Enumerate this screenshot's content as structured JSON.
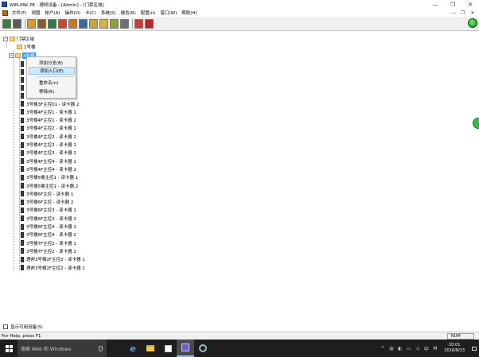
{
  "window": {
    "title": "WIN-PAK PE - 理邦设备 - [Admin] - [门禁区域]",
    "controls": [
      "—",
      "❐",
      "✕"
    ]
  },
  "menu": {
    "items": [
      "文件(F)",
      "视图",
      "帐户(A)",
      "操作(O)",
      "卡(C)",
      "系统(S)",
      "报告(R)",
      "配置(n)",
      "窗口(W)",
      "帮助(H)"
    ],
    "mdi_controls": [
      "—",
      "❐",
      "✕"
    ]
  },
  "toolbar": {
    "buttons": [
      {
        "icon": "door-icon",
        "color": "#3f7b3a"
      },
      {
        "icon": "grid-icon",
        "color": "#5b5b5b"
      },
      {
        "icon": "card-icon",
        "color": "#d89b2a"
      },
      {
        "icon": "book-icon",
        "color": "#8a5a2b"
      },
      {
        "icon": "person-icon",
        "color": "#2f7a3f"
      },
      {
        "icon": "key-icon",
        "color": "#c94a2a"
      },
      {
        "icon": "map-icon",
        "color": "#c07a2a"
      },
      {
        "icon": "report-icon",
        "color": "#3a69a8"
      },
      {
        "icon": "calendar-icon",
        "color": "#cfa236"
      },
      {
        "icon": "alarm-icon",
        "color": "#d8b13a"
      },
      {
        "icon": "note-icon",
        "color": "#8aa23a"
      },
      {
        "icon": "printer-icon",
        "color": "#6f6f6f"
      },
      {
        "icon": "restart-icon",
        "color": "#d03a3a"
      },
      {
        "icon": "exit-icon",
        "color": "#c82020"
      }
    ],
    "connection_color": "#12b312"
  },
  "tree": {
    "root": "门禁区域",
    "building1": "1号楼",
    "building2": "3号楼",
    "readers": [
      "3号楼3F主控01 - 读卡器 2",
      "3号楼4F主控1 - 读卡器 1",
      "3号楼4F主控1 - 读卡器 2",
      "3号楼4F主控2 - 读卡器 1",
      "3号楼4F主控2 - 读卡器 2",
      "3号楼4F主控3 - 读卡器 1",
      "3号楼4F主控3 - 读卡器 2",
      "3号楼4F主控4 - 读卡器 1",
      "3号楼4F主控4 - 读卡器 2",
      "3号楼5楼主控1 - 读卡器 1",
      "3号楼5楼主控1 - 读卡器 2",
      "3号楼6F主控 - 读卡器 1",
      "3号楼6F主控 - 读卡器 2",
      "3号楼6F主控3 - 读卡器 1",
      "3号楼6F主控3 - 读卡器 2",
      "3号楼6F主控4 - 读卡器 1",
      "3号楼6F主控4 - 读卡器 2",
      "3号楼7F主控2 - 读卡器 1",
      "3号楼7F主控2 - 读卡器 2",
      "理邦3号楼2F主控2 - 读卡器 1",
      "理邦3号楼2F主控2 - 读卡器 2"
    ]
  },
  "context_menu": {
    "items": [
      "添加分支(B)",
      "添加入口(E)",
      "重命名(n)",
      "移除(R)"
    ],
    "highlighted_index": 1
  },
  "show_devices_label": "显示可用设备(S)",
  "statusbar": {
    "help_text": "For Help, press F1",
    "num": "NUM"
  },
  "taskbar": {
    "search_placeholder": "搜索 Web 和 Windows",
    "tray_lang": "中",
    "time": "20:01",
    "date": "2016/8/13"
  }
}
